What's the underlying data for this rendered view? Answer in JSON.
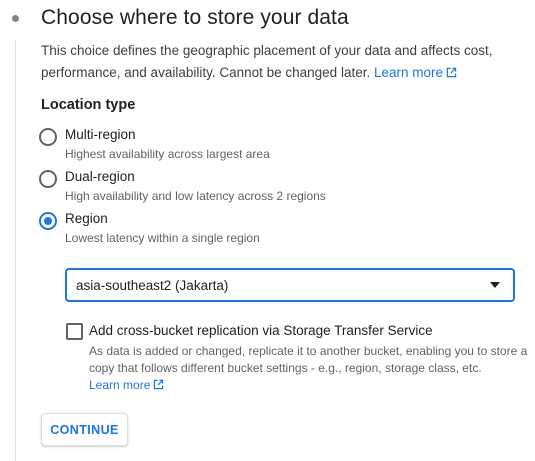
{
  "section": {
    "title": "Choose where to store your data",
    "description": "This choice defines the geographic placement of your data and affects cost, performance, and availability. Cannot be changed later.",
    "learn_more": "Learn more"
  },
  "location_type": {
    "label": "Location type",
    "options": [
      {
        "label": "Multi-region",
        "sub": "Highest availability across largest area",
        "checked": false
      },
      {
        "label": "Dual-region",
        "sub": "High availability and low latency across 2 regions",
        "checked": false
      },
      {
        "label": "Region",
        "sub": "Lowest latency within a single region",
        "checked": true
      }
    ],
    "selected_region": "asia-southeast2 (Jakarta)"
  },
  "replication": {
    "label": "Add cross-bucket replication via Storage Transfer Service",
    "description": "As data is added or changed, replicate it to another bucket, enabling you to store a copy that follows different bucket settings - e.g., region, storage class, etc.",
    "learn_more": "Learn more",
    "checked": false
  },
  "actions": {
    "continue_label": "CONTINUE"
  },
  "colors": {
    "accent": "#1a73e8",
    "text": "#202124",
    "secondary_text": "#5f6368"
  }
}
